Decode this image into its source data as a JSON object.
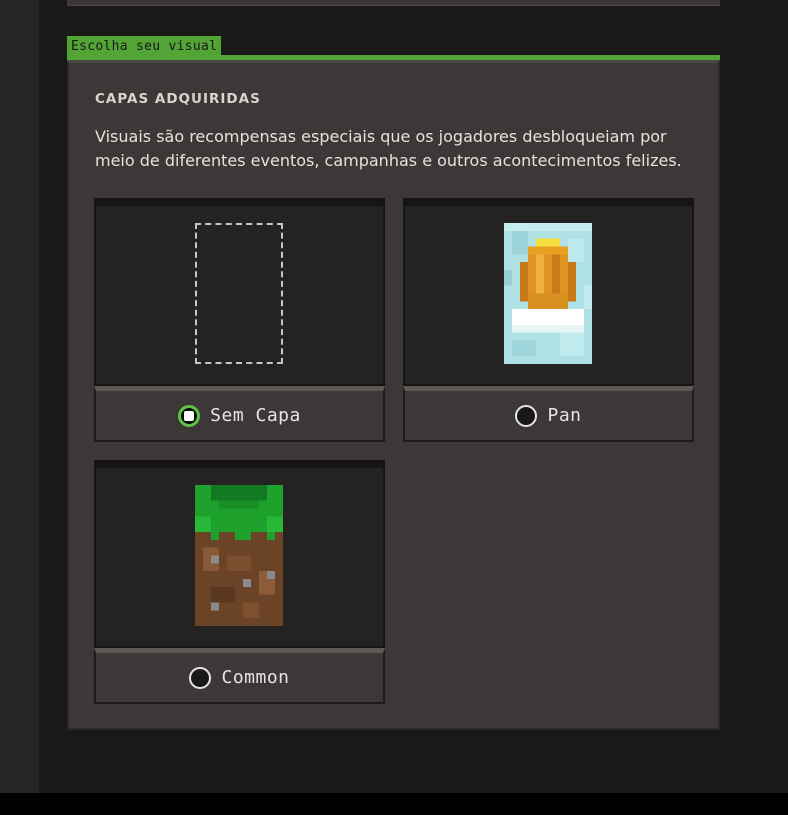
{
  "section": {
    "tab_label": "Escolha seu visual",
    "title": "CAPAS ADQUIRIDAS",
    "description": "Visuais são recompensas especiais que os jogadores desbloqueiam por meio de diferentes eventos, campanhas e outros acontecimentos felizes."
  },
  "capes": [
    {
      "label": "Sem Capa",
      "selected": true,
      "preview_icon": "empty-cape-placeholder-icon"
    },
    {
      "label": "Pan",
      "selected": false,
      "preview_icon": "pan-cape-icon"
    },
    {
      "label": "Common",
      "selected": false,
      "preview_icon": "common-grass-cape-icon"
    }
  ],
  "colors": {
    "accent_green": "#52a535",
    "radio_selected_ring": "#5cc544",
    "panel_bg": "#3b3837",
    "preview_bg": "#242322"
  }
}
